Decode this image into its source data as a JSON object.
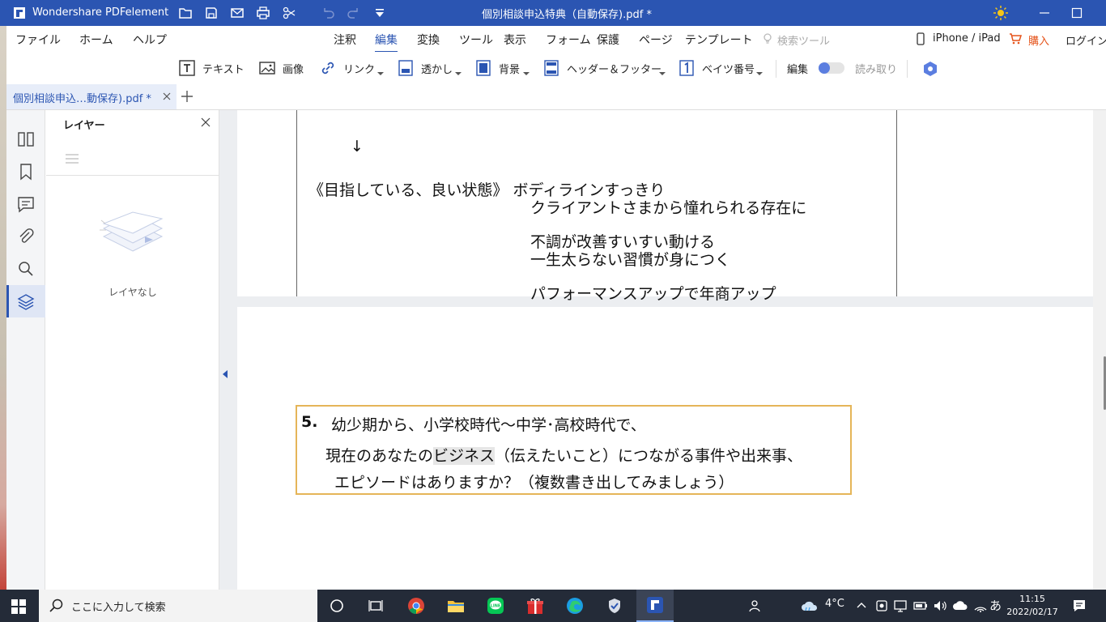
{
  "app": {
    "name": "Wondershare PDFelement",
    "document_title": "個別相談申込特典（自動保存).pdf *"
  },
  "menubar": {
    "left": [
      "ファイル",
      "ホーム",
      "ヘルプ"
    ],
    "tabs": [
      "注釈",
      "編集",
      "変換",
      "ツール",
      "表示",
      "フォーム",
      "保護",
      "ページ",
      "テンプレート"
    ],
    "active_tab": "編集",
    "search_tools": "検索ツール",
    "device": "iPhone / iPad",
    "buy": "購入",
    "login": "ログイン"
  },
  "toolbar": {
    "text": "テキスト",
    "image": "画像",
    "link": "リンク",
    "watermark": "透かし",
    "background": "背景",
    "header_footer": "ヘッダー＆フッター",
    "bates": "ベイツ番号",
    "edit": "編集",
    "read": "読み取り"
  },
  "tabs": {
    "doc_tab": "個別相談申込…動保存).pdf *"
  },
  "layer_panel": {
    "title": "レイヤー",
    "empty": "レイヤなし"
  },
  "document": {
    "arrow": "↓",
    "line1": "《目指している、良い状態》 ボディラインすっきり",
    "line2": "クライアントさまから憧れられる存在に",
    "line3": "不調が改善すいすい動ける",
    "line4": "一生太らない習慣が身につく",
    "line5": "パフォーマンスアップで年商アップ",
    "q_num": "5.",
    "q_line1": "幼少期から、小学校時代～中学･高校時代で、",
    "q_line2_pre": "現在のあなたの",
    "q_line2_hl": "ビジネス",
    "q_line2_post": "（伝えたいこと）につながる事件や出来事、",
    "q_line3": "エピソードはありますか？（複数書き出してみましょう）"
  },
  "taskbar": {
    "search_placeholder": "ここに入力して検索",
    "temperature": "4°C",
    "ime": "あ",
    "time": "11:15",
    "date": "2022/02/17"
  },
  "colors": {
    "brand": "#2b55b2",
    "buy": "#e5531a",
    "box_border": "#e5b558"
  }
}
